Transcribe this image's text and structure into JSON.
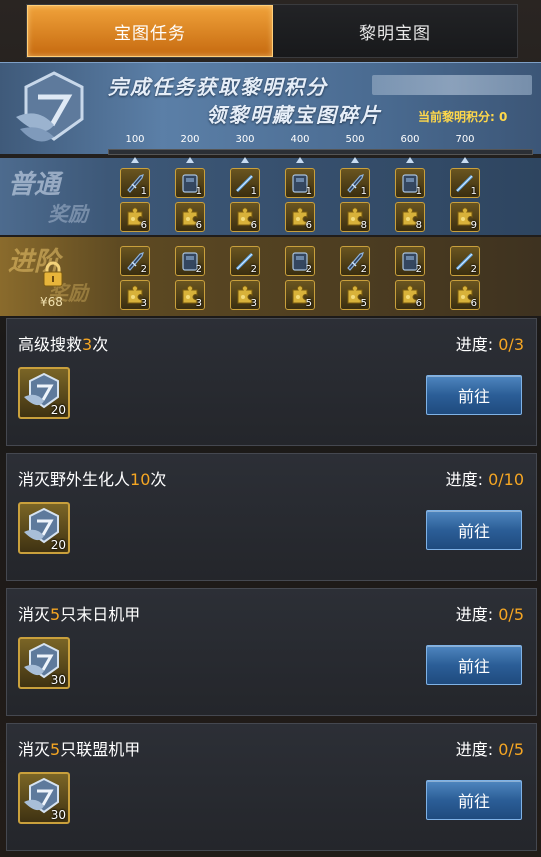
{
  "tabs": [
    {
      "label": "宝图任务",
      "active": true
    },
    {
      "label": "黎明宝图",
      "active": false
    }
  ],
  "banner": {
    "line1": "完成任务获取黎明积分",
    "line2": "领黎明藏宝图碎片",
    "points_label": "当前黎明积分: 0"
  },
  "rewards": {
    "milestones": [
      "100",
      "200",
      "300",
      "400",
      "500",
      "600",
      "700"
    ],
    "normal": {
      "title": "普通",
      "subtitle": "奖励",
      "items": [
        [
          {
            "icon": "rocket-icon",
            "count": "1"
          },
          {
            "icon": "puzzle-icon",
            "count": "6"
          }
        ],
        [
          {
            "icon": "armor-icon",
            "count": "1"
          },
          {
            "icon": "puzzle-icon",
            "count": "6"
          }
        ],
        [
          {
            "icon": "rifle-icon",
            "count": "1"
          },
          {
            "icon": "puzzle-icon",
            "count": "6"
          }
        ],
        [
          {
            "icon": "armor-icon",
            "count": "1"
          },
          {
            "icon": "puzzle-icon",
            "count": "6"
          }
        ],
        [
          {
            "icon": "rocket-icon",
            "count": "1"
          },
          {
            "icon": "puzzle-icon",
            "count": "8"
          }
        ],
        [
          {
            "icon": "armor-icon",
            "count": "1"
          },
          {
            "icon": "puzzle-icon",
            "count": "8"
          }
        ],
        [
          {
            "icon": "rifle-icon",
            "count": "1"
          },
          {
            "icon": "puzzle-icon",
            "count": "9"
          }
        ]
      ]
    },
    "advanced": {
      "title": "进阶",
      "subtitle": "奖励",
      "price": "¥68",
      "items": [
        [
          {
            "icon": "rocket-icon",
            "count": "2"
          },
          {
            "icon": "puzzle-icon",
            "count": "3"
          }
        ],
        [
          {
            "icon": "armor-icon",
            "count": "2"
          },
          {
            "icon": "puzzle-icon",
            "count": "3"
          }
        ],
        [
          {
            "icon": "rifle-icon",
            "count": "2"
          },
          {
            "icon": "puzzle-icon",
            "count": "3"
          }
        ],
        [
          {
            "icon": "armor-icon",
            "count": "2"
          },
          {
            "icon": "puzzle-icon",
            "count": "5"
          }
        ],
        [
          {
            "icon": "rocket-icon",
            "count": "2"
          },
          {
            "icon": "puzzle-icon",
            "count": "5"
          }
        ],
        [
          {
            "icon": "armor-icon",
            "count": "2"
          },
          {
            "icon": "puzzle-icon",
            "count": "6"
          }
        ],
        [
          {
            "icon": "rifle-icon",
            "count": "2"
          },
          {
            "icon": "puzzle-icon",
            "count": "6"
          }
        ]
      ]
    }
  },
  "tasks": [
    {
      "pre": "高级搜救",
      "num": "3",
      "post": "次",
      "progress_label": "进度:",
      "progress": "0/3",
      "reward_qty": "20",
      "button": "前往"
    },
    {
      "pre": "消灭野外生化人",
      "num": "10",
      "post": "次",
      "progress_label": "进度:",
      "progress": "0/10",
      "reward_qty": "20",
      "button": "前往"
    },
    {
      "pre": "消灭",
      "num": "5",
      "post": "只末日机甲",
      "progress_label": "进度:",
      "progress": "0/5",
      "reward_qty": "30",
      "button": "前往"
    },
    {
      "pre": "消灭",
      "num": "5",
      "post": "只联盟机甲",
      "progress_label": "进度:",
      "progress": "0/5",
      "reward_qty": "30",
      "button": "前往"
    }
  ],
  "colors": {
    "highlight": "#f5a623",
    "points": "#ffd84a",
    "tab_active": "#e08a24",
    "button": "#2b5e97"
  }
}
